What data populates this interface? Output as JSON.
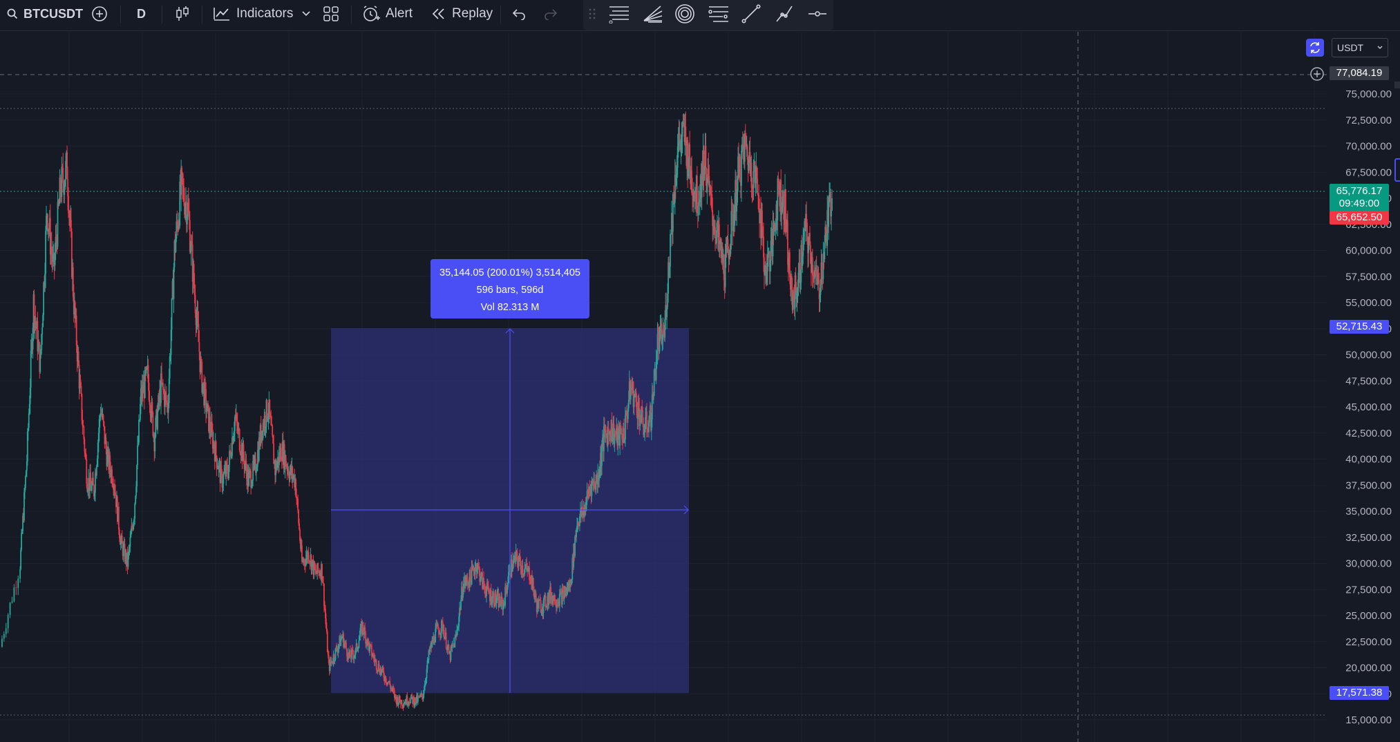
{
  "toolbar": {
    "symbol": "BTCUSDT",
    "interval": "D",
    "indicators_label": "Indicators",
    "alert_label": "Alert",
    "replay_label": "Replay"
  },
  "price_axis": {
    "currency": "USDT",
    "ticks": [
      "75,000.00",
      "72,500.00",
      "70,000.00",
      "67,500.00",
      "65,000.00",
      "62,500.00",
      "60,000.00",
      "57,500.00",
      "55,000.00",
      "52,500.00",
      "50,000.00",
      "47,500.00",
      "45,000.00",
      "42,500.00",
      "40,000.00",
      "37,500.00",
      "35,000.00",
      "32,500.00",
      "30,000.00",
      "27,500.00",
      "25,000.00",
      "22,500.00",
      "20,000.00",
      "17,500.00",
      "15,000.00"
    ],
    "crosshair_price": "77,084.19",
    "last_price": "65,776.17",
    "countdown": "09:49:00",
    "bid_price": "65,652.50",
    "measure_top": "52,715.43",
    "measure_bottom": "17,571.38"
  },
  "measure": {
    "line1": "35,144.05 (200.01%) 3,514,405",
    "line2": "596 bars, 596d",
    "line3": "Vol 82.313 M"
  },
  "colors": {
    "background": "#161a25",
    "up": "#26a69a",
    "down": "#f23645",
    "measure_fill": "#2a2e6b",
    "measure_accent": "#4a4ff5"
  },
  "chart_data": {
    "type": "candlestick",
    "symbol": "BTCUSDT",
    "interval": "D",
    "ylim": [
      14000,
      78500
    ],
    "close_path": [
      [
        0,
        22000
      ],
      [
        3,
        30000
      ],
      [
        4,
        40000
      ],
      [
        5,
        55000
      ],
      [
        6,
        49000
      ],
      [
        7,
        64000
      ],
      [
        8,
        58000
      ],
      [
        9,
        66000
      ],
      [
        10,
        68000
      ],
      [
        11,
        55000
      ],
      [
        12,
        46000
      ],
      [
        13,
        38000
      ],
      [
        14,
        37000
      ],
      [
        15,
        45000
      ],
      [
        16,
        40000
      ],
      [
        17,
        38000
      ],
      [
        18,
        32000
      ],
      [
        19,
        30000
      ],
      [
        20,
        35000
      ],
      [
        21,
        46000
      ],
      [
        22,
        48000
      ],
      [
        23,
        42000
      ],
      [
        24,
        47000
      ],
      [
        25,
        45000
      ],
      [
        26,
        60000
      ],
      [
        27,
        66000
      ],
      [
        28,
        64000
      ],
      [
        29,
        56000
      ],
      [
        30,
        48000
      ],
      [
        31,
        44000
      ],
      [
        32,
        41000
      ],
      [
        33,
        38000
      ],
      [
        34,
        39000
      ],
      [
        35,
        44000
      ],
      [
        36,
        41000
      ],
      [
        37,
        38000
      ],
      [
        38,
        39000
      ],
      [
        39,
        43000
      ],
      [
        40,
        45000
      ],
      [
        41,
        39000
      ],
      [
        42,
        41000
      ],
      [
        43,
        39000
      ],
      [
        44,
        38000
      ],
      [
        45,
        30000
      ],
      [
        46,
        31000
      ],
      [
        47,
        29000
      ],
      [
        48,
        29500
      ],
      [
        49,
        20000
      ],
      [
        50,
        21500
      ],
      [
        51,
        23000
      ],
      [
        52,
        21000
      ],
      [
        53,
        21500
      ],
      [
        54,
        24000
      ],
      [
        55,
        22000
      ],
      [
        56,
        20500
      ],
      [
        57,
        19500
      ],
      [
        58,
        18500
      ],
      [
        59,
        17000
      ],
      [
        60,
        16700
      ],
      [
        61,
        17000
      ],
      [
        62,
        16800
      ],
      [
        63,
        17300
      ],
      [
        64,
        21500
      ],
      [
        65,
        23500
      ],
      [
        66,
        24000
      ],
      [
        67,
        21000
      ],
      [
        68,
        23000
      ],
      [
        69,
        28000
      ],
      [
        70,
        28500
      ],
      [
        71,
        30000
      ],
      [
        72,
        28000
      ],
      [
        73,
        27000
      ],
      [
        74,
        26500
      ],
      [
        75,
        26000
      ],
      [
        76,
        29500
      ],
      [
        77,
        30500
      ],
      [
        78,
        29500
      ],
      [
        79,
        29000
      ],
      [
        80,
        26000
      ],
      [
        81,
        26000
      ],
      [
        82,
        27000
      ],
      [
        83,
        26500
      ],
      [
        84,
        27000
      ],
      [
        85,
        28000
      ],
      [
        86,
        34000
      ],
      [
        87,
        35000
      ],
      [
        88,
        37500
      ],
      [
        89,
        38000
      ],
      [
        90,
        42000
      ],
      [
        91,
        43000
      ],
      [
        92,
        42000
      ],
      [
        93,
        42500
      ],
      [
        94,
        47000
      ],
      [
        95,
        45000
      ],
      [
        96,
        43000
      ],
      [
        97,
        44000
      ],
      [
        98,
        51000
      ],
      [
        99,
        52000
      ],
      [
        100,
        62000
      ],
      [
        101,
        70000
      ],
      [
        102,
        71000
      ],
      [
        103,
        67000
      ],
      [
        104,
        65000
      ],
      [
        105,
        69000
      ],
      [
        106,
        64000
      ],
      [
        107,
        61000
      ],
      [
        108,
        58000
      ],
      [
        109,
        62000
      ],
      [
        110,
        67000
      ],
      [
        111,
        70000
      ],
      [
        112,
        68000
      ],
      [
        113,
        66000
      ],
      [
        114,
        58000
      ],
      [
        115,
        60000
      ],
      [
        116,
        66000
      ],
      [
        117,
        64000
      ],
      [
        118,
        55000
      ],
      [
        119,
        57000
      ],
      [
        120,
        62000
      ],
      [
        121,
        59000
      ],
      [
        122,
        56000
      ],
      [
        123,
        61000
      ],
      [
        124,
        65800
      ]
    ],
    "measure_range": {
      "from_price": 17571.38,
      "to_price": 52715.43,
      "change": 35144.05,
      "change_pct": 200.01,
      "bars": 596
    }
  }
}
